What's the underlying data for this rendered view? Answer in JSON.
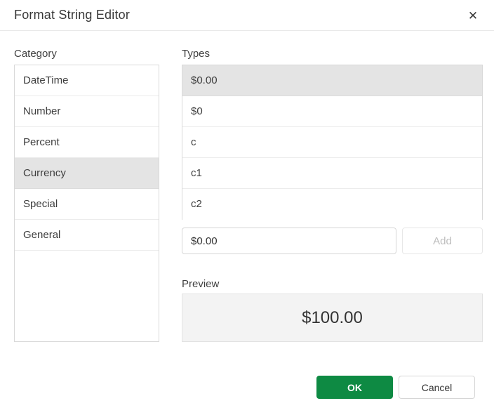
{
  "dialog": {
    "title": "Format String Editor",
    "close_icon": "✕"
  },
  "category_panel": {
    "label": "Category",
    "items": [
      {
        "label": "DateTime",
        "selected": false
      },
      {
        "label": "Number",
        "selected": false
      },
      {
        "label": "Percent",
        "selected": false
      },
      {
        "label": "Currency",
        "selected": true
      },
      {
        "label": "Special",
        "selected": false
      },
      {
        "label": "General",
        "selected": false
      }
    ]
  },
  "types_panel": {
    "label": "Types",
    "items": [
      {
        "label": "$0.00",
        "selected": true
      },
      {
        "label": "$0",
        "selected": false
      },
      {
        "label": "c",
        "selected": false
      },
      {
        "label": "c1",
        "selected": false
      },
      {
        "label": "c2",
        "selected": false
      }
    ]
  },
  "custom_format": {
    "input_value": "$0.00",
    "add_button_label": "Add"
  },
  "preview_panel": {
    "label": "Preview",
    "value": "$100.00"
  },
  "footer": {
    "ok_label": "OK",
    "cancel_label": "Cancel"
  },
  "colors": {
    "accent_green": "#0e8a43",
    "selected_item_bg": "#e4e4e4"
  }
}
